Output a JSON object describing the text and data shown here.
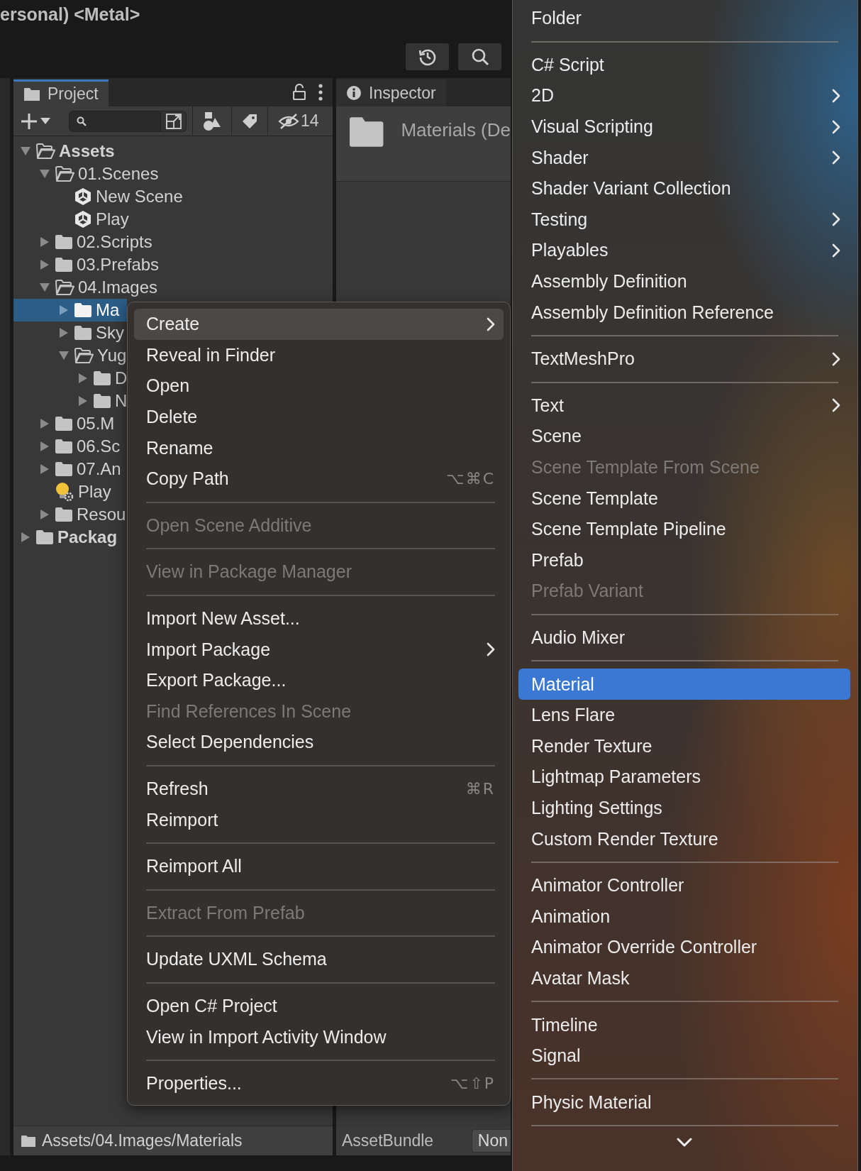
{
  "title_bar": {
    "title": "ersonal) <Metal>"
  },
  "project_panel": {
    "tab": {
      "label": "Project",
      "selected": true
    },
    "hidden_count": "14",
    "tree": [
      {
        "label": "Assets",
        "kind": "folder",
        "expanded": true,
        "selected": false,
        "children": [
          {
            "label": "01.Scenes",
            "kind": "folder",
            "expanded": true,
            "selected": false,
            "children": [
              {
                "label": "New Scene",
                "kind": "scene",
                "selected": false
              },
              {
                "label": "Play",
                "kind": "scene",
                "selected": false
              }
            ]
          },
          {
            "label": "02.Scripts",
            "kind": "folder",
            "expanded": false,
            "selected": false
          },
          {
            "label": "03.Prefabs",
            "kind": "folder",
            "expanded": false,
            "selected": false
          },
          {
            "label": "04.Images",
            "kind": "folder",
            "expanded": true,
            "selected": false,
            "children": [
              {
                "label": "Ma",
                "kind": "folder",
                "expanded": false,
                "selected": true
              },
              {
                "label": "Sky",
                "kind": "folder",
                "expanded": false,
                "selected": false
              },
              {
                "label": "Yug",
                "kind": "folder",
                "expanded": true,
                "selected": false,
                "children": [
                  {
                    "label": "D",
                    "kind": "folder",
                    "expanded": false,
                    "selected": false
                  },
                  {
                    "label": "N",
                    "kind": "folder",
                    "expanded": false,
                    "selected": false
                  }
                ]
              }
            ]
          },
          {
            "label": "05.M",
            "kind": "folder",
            "expanded": false,
            "selected": false
          },
          {
            "label": "06.Sc",
            "kind": "folder",
            "expanded": false,
            "selected": false
          },
          {
            "label": "07.An",
            "kind": "folder",
            "expanded": false,
            "selected": false
          },
          {
            "label": "Play",
            "kind": "lighting",
            "selected": false
          },
          {
            "label": "Resou",
            "kind": "folder",
            "expanded": false,
            "selected": false
          }
        ]
      },
      {
        "label": "Packag",
        "kind": "folder",
        "expanded": false,
        "selected": false
      }
    ],
    "path": "Assets/04.Images/Materials"
  },
  "inspector_panel": {
    "tab": {
      "label": "Inspector",
      "selected": false
    },
    "title": "Materials (De",
    "asset_bundle": {
      "label": "AssetBundle",
      "value": "Non"
    }
  },
  "context_menu": {
    "items": [
      {
        "kind": "item",
        "label": "Create",
        "selected": true,
        "disabled": false,
        "submenu": true
      },
      {
        "kind": "item",
        "label": "Reveal in Finder",
        "selected": false,
        "disabled": false,
        "submenu": false
      },
      {
        "kind": "item",
        "label": "Open",
        "selected": false,
        "disabled": false,
        "submenu": false
      },
      {
        "kind": "item",
        "label": "Delete",
        "selected": false,
        "disabled": false,
        "submenu": false
      },
      {
        "kind": "item",
        "label": "Rename",
        "selected": false,
        "disabled": false,
        "submenu": false
      },
      {
        "kind": "item",
        "label": "Copy Path",
        "selected": false,
        "disabled": false,
        "submenu": false,
        "shortcut": "⌥⌘C"
      },
      {
        "kind": "separator"
      },
      {
        "kind": "item",
        "label": "Open Scene Additive",
        "selected": false,
        "disabled": true,
        "submenu": false
      },
      {
        "kind": "separator"
      },
      {
        "kind": "item",
        "label": "View in Package Manager",
        "selected": false,
        "disabled": true,
        "submenu": false
      },
      {
        "kind": "separator"
      },
      {
        "kind": "item",
        "label": "Import New Asset...",
        "selected": false,
        "disabled": false,
        "submenu": false
      },
      {
        "kind": "item",
        "label": "Import Package",
        "selected": false,
        "disabled": false,
        "submenu": true
      },
      {
        "kind": "item",
        "label": "Export Package...",
        "selected": false,
        "disabled": false,
        "submenu": false
      },
      {
        "kind": "item",
        "label": "Find References In Scene",
        "selected": false,
        "disabled": true,
        "submenu": false
      },
      {
        "kind": "item",
        "label": "Select Dependencies",
        "selected": false,
        "disabled": false,
        "submenu": false
      },
      {
        "kind": "separator"
      },
      {
        "kind": "item",
        "label": "Refresh",
        "selected": false,
        "disabled": false,
        "submenu": false,
        "shortcut": "⌘R"
      },
      {
        "kind": "item",
        "label": "Reimport",
        "selected": false,
        "disabled": false,
        "submenu": false
      },
      {
        "kind": "separator"
      },
      {
        "kind": "item",
        "label": "Reimport All",
        "selected": false,
        "disabled": false,
        "submenu": false
      },
      {
        "kind": "separator"
      },
      {
        "kind": "item",
        "label": "Extract From Prefab",
        "selected": false,
        "disabled": true,
        "submenu": false
      },
      {
        "kind": "separator"
      },
      {
        "kind": "item",
        "label": "Update UXML Schema",
        "selected": false,
        "disabled": false,
        "submenu": false
      },
      {
        "kind": "separator"
      },
      {
        "kind": "item",
        "label": "Open C# Project",
        "selected": false,
        "disabled": false,
        "submenu": false
      },
      {
        "kind": "item",
        "label": "View in Import Activity Window",
        "selected": false,
        "disabled": false,
        "submenu": false
      },
      {
        "kind": "separator"
      },
      {
        "kind": "item",
        "label": "Properties...",
        "selected": false,
        "disabled": false,
        "submenu": false,
        "shortcut": "⌥⇧P"
      }
    ]
  },
  "create_submenu": {
    "items": [
      {
        "kind": "item",
        "label": "Folder",
        "selected": false,
        "disabled": false,
        "submenu": false
      },
      {
        "kind": "separator"
      },
      {
        "kind": "item",
        "label": "C# Script",
        "selected": false,
        "disabled": false,
        "submenu": false
      },
      {
        "kind": "item",
        "label": "2D",
        "selected": false,
        "disabled": false,
        "submenu": true
      },
      {
        "kind": "item",
        "label": "Visual Scripting",
        "selected": false,
        "disabled": false,
        "submenu": true
      },
      {
        "kind": "item",
        "label": "Shader",
        "selected": false,
        "disabled": false,
        "submenu": true
      },
      {
        "kind": "item",
        "label": "Shader Variant Collection",
        "selected": false,
        "disabled": false,
        "submenu": false
      },
      {
        "kind": "item",
        "label": "Testing",
        "selected": false,
        "disabled": false,
        "submenu": true
      },
      {
        "kind": "item",
        "label": "Playables",
        "selected": false,
        "disabled": false,
        "submenu": true
      },
      {
        "kind": "item",
        "label": "Assembly Definition",
        "selected": false,
        "disabled": false,
        "submenu": false
      },
      {
        "kind": "item",
        "label": "Assembly Definition Reference",
        "selected": false,
        "disabled": false,
        "submenu": false
      },
      {
        "kind": "separator"
      },
      {
        "kind": "item",
        "label": "TextMeshPro",
        "selected": false,
        "disabled": false,
        "submenu": true
      },
      {
        "kind": "separator"
      },
      {
        "kind": "item",
        "label": "Text",
        "selected": false,
        "disabled": false,
        "submenu": true
      },
      {
        "kind": "item",
        "label": "Scene",
        "selected": false,
        "disabled": false,
        "submenu": false
      },
      {
        "kind": "item",
        "label": "Scene Template From Scene",
        "selected": false,
        "disabled": true,
        "submenu": false
      },
      {
        "kind": "item",
        "label": "Scene Template",
        "selected": false,
        "disabled": false,
        "submenu": false
      },
      {
        "kind": "item",
        "label": "Scene Template Pipeline",
        "selected": false,
        "disabled": false,
        "submenu": false
      },
      {
        "kind": "item",
        "label": "Prefab",
        "selected": false,
        "disabled": false,
        "submenu": false
      },
      {
        "kind": "item",
        "label": "Prefab Variant",
        "selected": false,
        "disabled": true,
        "submenu": false
      },
      {
        "kind": "separator"
      },
      {
        "kind": "item",
        "label": "Audio Mixer",
        "selected": false,
        "disabled": false,
        "submenu": false
      },
      {
        "kind": "separator"
      },
      {
        "kind": "item",
        "label": "Material",
        "selected": true,
        "disabled": false,
        "submenu": false
      },
      {
        "kind": "item",
        "label": "Lens Flare",
        "selected": false,
        "disabled": false,
        "submenu": false
      },
      {
        "kind": "item",
        "label": "Render Texture",
        "selected": false,
        "disabled": false,
        "submenu": false
      },
      {
        "kind": "item",
        "label": "Lightmap Parameters",
        "selected": false,
        "disabled": false,
        "submenu": false
      },
      {
        "kind": "item",
        "label": "Lighting Settings",
        "selected": false,
        "disabled": false,
        "submenu": false
      },
      {
        "kind": "item",
        "label": "Custom Render Texture",
        "selected": false,
        "disabled": false,
        "submenu": false
      },
      {
        "kind": "separator"
      },
      {
        "kind": "item",
        "label": "Animator Controller",
        "selected": false,
        "disabled": false,
        "submenu": false
      },
      {
        "kind": "item",
        "label": "Animation",
        "selected": false,
        "disabled": false,
        "submenu": false
      },
      {
        "kind": "item",
        "label": "Animator Override Controller",
        "selected": false,
        "disabled": false,
        "submenu": false
      },
      {
        "kind": "item",
        "label": "Avatar Mask",
        "selected": false,
        "disabled": false,
        "submenu": false
      },
      {
        "kind": "separator"
      },
      {
        "kind": "item",
        "label": "Timeline",
        "selected": false,
        "disabled": false,
        "submenu": false
      },
      {
        "kind": "item",
        "label": "Signal",
        "selected": false,
        "disabled": false,
        "submenu": false
      },
      {
        "kind": "separator"
      },
      {
        "kind": "item",
        "label": "Physic Material",
        "selected": false,
        "disabled": false,
        "submenu": false
      },
      {
        "kind": "separator"
      }
    ]
  }
}
